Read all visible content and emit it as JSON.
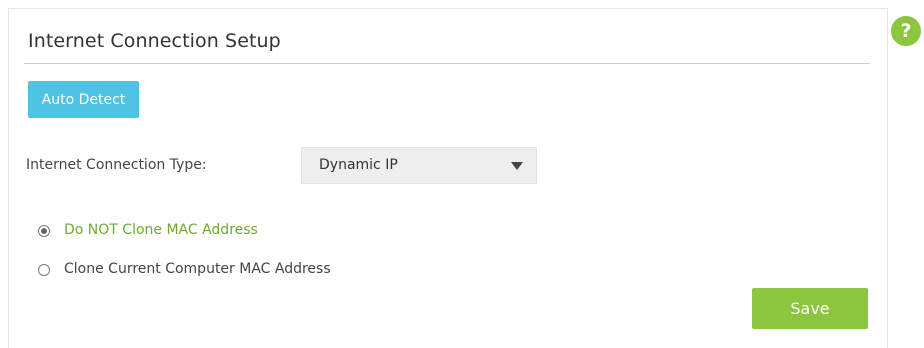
{
  "panel": {
    "title": "Internet Connection Setup",
    "help_glyph": "?"
  },
  "auto_detect": {
    "label": "Auto Detect"
  },
  "connection_type": {
    "label": "Internet Connection Type:",
    "selected": "Dynamic IP"
  },
  "mac_options": [
    {
      "label": "Do NOT Clone MAC Address",
      "checked": true
    },
    {
      "label": "Clone Current Computer MAC Address",
      "checked": false
    }
  ],
  "save": {
    "label": "Save"
  },
  "colors": {
    "accent_green": "#8cc63f",
    "accent_blue": "#4fc3e4",
    "selected_text_green": "#6eaa2e"
  },
  "icons": {
    "help": "help-icon",
    "dropdown": "chevron-down-icon"
  }
}
